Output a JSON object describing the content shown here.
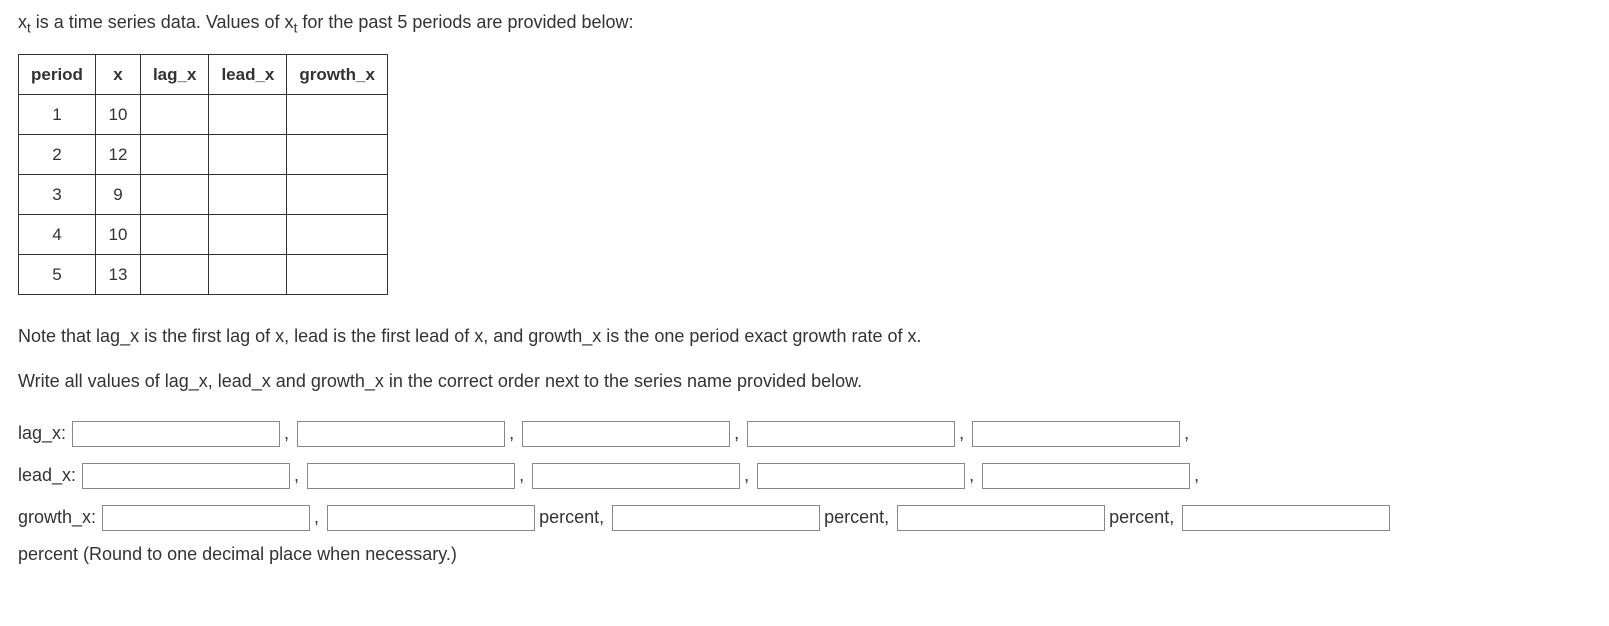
{
  "intro": {
    "prefix1": "x",
    "sub1": "t",
    "mid": " is a time series data. Values of x",
    "sub2": "t",
    "suffix": " for the past 5 periods are provided below:"
  },
  "table": {
    "headers": [
      "period",
      "x",
      "lag_x",
      "lead_x",
      "growth_x"
    ],
    "rows": [
      {
        "period": "1",
        "x": "10"
      },
      {
        "period": "2",
        "x": "12"
      },
      {
        "period": "3",
        "x": "9"
      },
      {
        "period": "4",
        "x": "10"
      },
      {
        "period": "5",
        "x": "13"
      }
    ]
  },
  "note": "Note that lag_x is the first lag of x, lead is the first lead of x, and growth_x is the one period exact growth rate of x.",
  "instruction": "Write all values of lag_x, lead_x and growth_x in the correct order next to the series name provided below.",
  "labels": {
    "lag_x": "lag_x:",
    "lead_x": "lead_x:",
    "growth_x": "growth_x:"
  },
  "comma": ",",
  "percent_comma": " percent,",
  "footer": "percent (Round to one decimal place when necessary.)"
}
